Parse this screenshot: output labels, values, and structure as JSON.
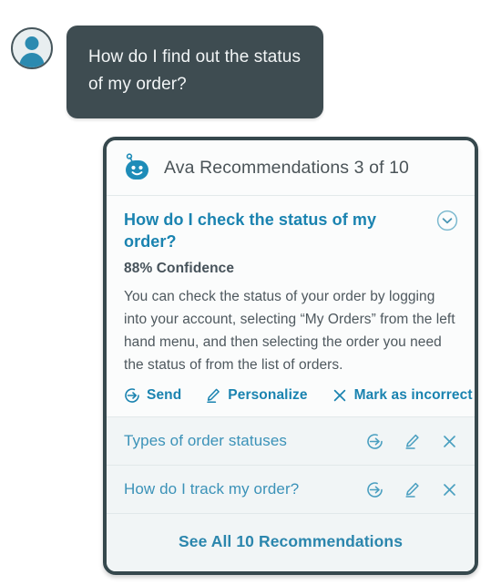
{
  "conversation": {
    "user": {
      "avatar_icon": "user-avatar-icon",
      "message": "How do I find out the status of my order?"
    }
  },
  "card": {
    "header": {
      "bot_icon": "ava-bot-icon",
      "title": "Ava Recommendations 3 of 10"
    },
    "expanded_recommendation": {
      "title": "How do I check  the status of my order?",
      "collapse_icon": "chevron-down-circle-icon",
      "confidence": "88% Confidence",
      "answer": "You can check the status of your order by logging into your account, selecting “My Orders” from the left hand menu, and then selecting the order you need the status of from the list of orders.",
      "actions": [
        {
          "label": "Send",
          "icon": "send-circle-icon"
        },
        {
          "label": "Personalize",
          "icon": "pencil-icon"
        },
        {
          "label": "Mark as incorrect",
          "icon": "close-x-icon"
        }
      ]
    },
    "collapsed_recommendations": [
      {
        "title": "Types of order statuses",
        "actions": [
          {
            "icon": "send-circle-icon"
          },
          {
            "icon": "pencil-icon"
          },
          {
            "icon": "close-x-icon"
          }
        ]
      },
      {
        "title": "How do I track my order?",
        "actions": [
          {
            "icon": "send-circle-icon"
          },
          {
            "icon": "pencil-icon"
          },
          {
            "icon": "close-x-icon"
          }
        ]
      }
    ],
    "footer": {
      "see_all_label": "See All 10 Recommendations"
    }
  },
  "colors": {
    "accent_blue": "#1a83b0",
    "link_blue": "#3b92b8",
    "bubble_dark": "#3e4c51",
    "card_border": "#36484d",
    "text_gray": "#4e585e"
  }
}
